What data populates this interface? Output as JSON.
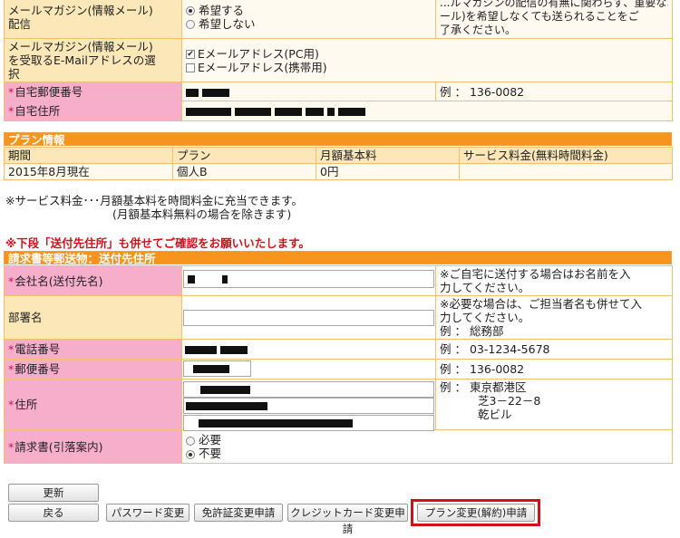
{
  "colors": {
    "accent": "#f7941d",
    "pink_label": "#f7aecb",
    "yellow_label": "#fbe7b7",
    "red_text": "#d0101a",
    "highlight": "#d0101a"
  },
  "top_form": {
    "magazine_label": "メールマガジン(情報メール)配信",
    "magazine_label_line1": "メールマガジン(情報メール)",
    "magazine_label_line2": "配信",
    "opt_yes": "希望する",
    "opt_no": "希望しない",
    "magazine_note_line1": "...ルマガジンの配信の有無に関わらず、重要なお知らせ(メ",
    "magazine_note_line2": "ール)を希望しなくても送られることをご",
    "magazine_note_line3": "了承ください。",
    "email_label_line1": "メールマガジン(情報メール)",
    "email_label_line2": "を受取るE-Mailアドレスの選",
    "email_label_line3": "択",
    "email_pc": "Eメールアドレス(PC用)",
    "email_mobile": "Eメールアドレス(携帯用)",
    "zip_label": "自宅郵便番号",
    "zip_example": "例 ： 136-0082",
    "address_label": "自宅住所"
  },
  "plan": {
    "band": "プラン情報",
    "headers": [
      "期間",
      "プラン",
      "月額基本料",
      "サービス料金(無料時間料金)"
    ],
    "row": [
      "2015年8月現在",
      "個人B",
      "0円",
      ""
    ]
  },
  "service_note_line1": "※サービス料金･･･月額基本料を時間料金に充当できます。",
  "service_note_line2": "(月額基本料無料の場合を除きます)",
  "warning": "※下段「送付先住所」も併せてご確認をお願いいたします。",
  "billing": {
    "band": "請求書等郵送物：送付先住所",
    "company_label": "会社名(送付先名)",
    "company_note_line1": "※ご自宅に送付する場合はお名前を入",
    "company_note_line2": "力してください。",
    "dept_label": "部署名",
    "dept_note_line1": "※必要な場合は、ご担当者名も併せて入",
    "dept_note_line2": "力してください。",
    "dept_note_line3": "例 ： 総務部",
    "phone_label": "電話番号",
    "phone_example": "例 ： 03-1234-5678",
    "zip_label": "郵便番号",
    "zip_example": "例 ： 136-0082",
    "address_label": "住所",
    "addr_example_line1": "例 ： 東京都港区",
    "addr_example_line2": "芝3－22－8",
    "addr_example_line3": "乾ビル",
    "invoice_label": "請求書(引落案内)",
    "invoice_opt_need": "必要",
    "invoice_opt_no": "不要"
  },
  "buttons": {
    "update": "更新",
    "back": "戻る",
    "password": "パスワード変更",
    "license": "免許証変更申請",
    "credit": "クレジットカード変更申請",
    "plan_change": "プラン変更(解約)申請"
  }
}
